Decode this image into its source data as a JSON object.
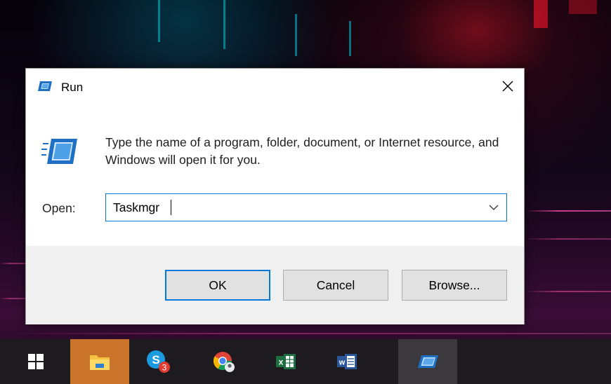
{
  "dialog": {
    "title": "Run",
    "description": "Type the name of a program, folder, document, or Internet resource, and Windows will open it for you.",
    "open_label": "Open:",
    "open_value": "Taskmgr",
    "buttons": {
      "ok": "OK",
      "cancel": "Cancel",
      "browse": "Browse..."
    },
    "icons": {
      "title": "run-icon",
      "close": "close-icon",
      "large": "run-icon",
      "dropdown": "chevron-down-icon"
    }
  },
  "taskbar": {
    "items": [
      {
        "name": "start",
        "icon": "windows-logo-icon"
      },
      {
        "name": "file-explorer",
        "icon": "folder-icon",
        "state": "active"
      },
      {
        "name": "skype",
        "icon": "skype-icon",
        "badge": "3"
      },
      {
        "name": "chrome",
        "icon": "chrome-icon"
      },
      {
        "name": "excel",
        "icon": "excel-icon"
      },
      {
        "name": "word",
        "icon": "word-icon"
      },
      {
        "name": "run",
        "icon": "run-icon",
        "state": "running"
      }
    ]
  },
  "colors": {
    "accent": "#0078d7",
    "explorer_active": "#c9742a",
    "taskbar": "#1d1a20"
  }
}
